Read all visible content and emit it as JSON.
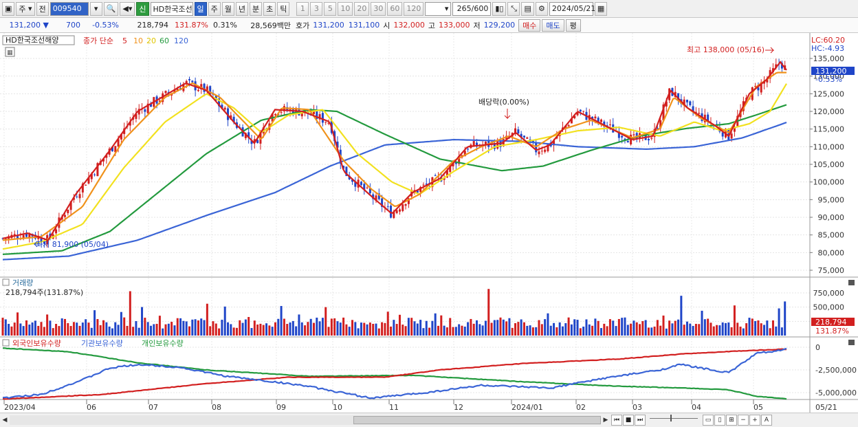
{
  "toolbar": {
    "period_select": "주",
    "prev_label": "전",
    "stock_code": "009540",
    "stock_name_badge": "신",
    "stock_name": "HD한국조선",
    "tabs": [
      "일",
      "주",
      "월",
      "년",
      "분",
      "초",
      "틱"
    ],
    "active_tab_index": 0,
    "intervals": [
      "1",
      "3",
      "5",
      "10",
      "20",
      "30",
      "60",
      "120"
    ],
    "count_value": "265",
    "count_total": "/600",
    "date_value": "2024/05/21"
  },
  "quote": {
    "price": "131,200",
    "direction": "▼",
    "change": "700",
    "change_pct": "-0.53%",
    "volume": "218,794",
    "volume_pct": "131.87%",
    "turnover": "0.31%",
    "amount": "28,569백만",
    "bid_label": "호가",
    "ask": "131,200",
    "bid": "131,100",
    "open_label": "시",
    "open": "132,000",
    "high_label": "고",
    "high": "133,000",
    "low_label": "저",
    "low": "129,200",
    "buy_button": "매수",
    "sell_button": "매도",
    "eval_button": "평"
  },
  "price_panel": {
    "stock_label": "HD한국조선해양",
    "ma_title": "종가 단순",
    "ma_periods": [
      "5",
      "10",
      "20",
      "60",
      "120"
    ],
    "ma_colors": [
      "#d21f1f",
      "#f0921b",
      "#f2e11f",
      "#239a3e",
      "#3a64d6"
    ],
    "lc_label": "LC:60.20",
    "hc_label": "HC:-4.93",
    "max_annotation": "최고 138,000 (05/16)",
    "min_annotation": "최저 81,900 (05/04)",
    "dividend_annotation": "배당락(0.00%)",
    "current_price_tag": "131,200",
    "current_pct_tag": "-0.53%",
    "y_ticks": [
      "135,000",
      "130,000",
      "125,000",
      "120,000",
      "115,000",
      "110,000",
      "105,000",
      "100,000",
      "95,000",
      "90,000",
      "85,000",
      "80,000",
      "75,000"
    ]
  },
  "volume_panel": {
    "title": "거래량",
    "value_label": "218,794주(131.87%)",
    "y_ticks": [
      "750,000",
      "500,000",
      "250,000"
    ],
    "current_tag": "218,794",
    "current_pct_tag": "131.87%"
  },
  "holding_panel": {
    "series_labels": [
      "외국인보유수량",
      "기관보유수량",
      "개인보유수량"
    ],
    "series_colors": [
      "#d21f1f",
      "#3a64d6",
      "#239a3e"
    ],
    "y_ticks": [
      "0",
      "-2,500,000",
      "-5,000,000"
    ]
  },
  "x_axis": {
    "labels": [
      "2023/04",
      "06",
      "07",
      "08",
      "09",
      "10",
      "11",
      "12",
      "2024/01",
      "02",
      "03",
      "04",
      "05",
      "05/21"
    ]
  },
  "chart_data": {
    "type": "line",
    "title": "",
    "series": [
      {
        "name": "5",
        "x": [
          "2023/04",
          "06",
          "07",
          "08",
          "09",
          "10",
          "11",
          "12",
          "2024/01",
          "02",
          "03",
          "04",
          "05",
          "05/21"
        ],
        "values": [
          83000,
          96000,
          125000,
          128000,
          113000,
          105000,
          92000,
          110000,
          114000,
          118000,
          114000,
          115000,
          132000,
          131200
        ]
      },
      {
        "name": "60",
        "x": [
          "2023/04",
          "06",
          "07",
          "08",
          "09",
          "10",
          "11",
          "12",
          "2024/01",
          "02",
          "03",
          "04",
          "05",
          "05/21"
        ],
        "values": [
          79500,
          84000,
          95000,
          112000,
          119000,
          114000,
          107000,
          104000,
          103500,
          108500,
          113500,
          117000,
          121000,
          122000
        ]
      },
      {
        "name": "120",
        "x": [
          "2023/04",
          "06",
          "07",
          "08",
          "09",
          "10",
          "11",
          "12",
          "2024/01",
          "02",
          "03",
          "04",
          "05",
          "05/21"
        ],
        "values": [
          77500,
          80000,
          86000,
          93000,
          101000,
          107000,
          110000,
          112000,
          111000,
          109500,
          109000,
          110000,
          114000,
          117000
        ]
      }
    ],
    "ylim": [
      75000,
      138000
    ],
    "legend": "top-left"
  }
}
